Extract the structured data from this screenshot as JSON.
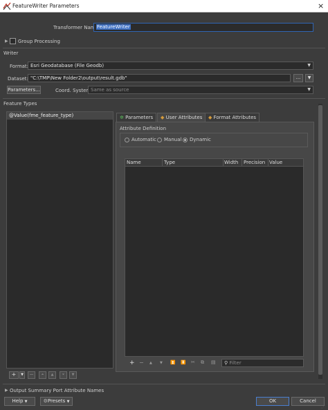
{
  "window": {
    "title": "FeatureWriter Parameters",
    "close_glyph": "×"
  },
  "transformer": {
    "label": "Transformer Name:",
    "value": "FeatureWriter"
  },
  "group_processing": {
    "label": "Group Processing",
    "checked": false
  },
  "writer": {
    "section_label": "Writer",
    "format_label": "Format:",
    "format_value": "Esri Geodatabase (File Geodb)",
    "dataset_label": "Dataset:",
    "dataset_value": "\"C:\\TMP\\New Folder2\\output\\result.gdb\"",
    "browse_label": "...",
    "parameters_button": "Parameters...",
    "coord_label": "Coord. System:",
    "coord_placeholder": "Same as source"
  },
  "feature_types": {
    "section_label": "Feature Types",
    "items": [
      "@Value(fme_feature_type)"
    ]
  },
  "tabs": [
    {
      "label": "Parameters",
      "icon": "gear-icon",
      "active": false
    },
    {
      "label": "User Attributes",
      "icon": "diamond-icon",
      "active": true
    },
    {
      "label": "Format Attributes",
      "icon": "diamond-icon",
      "active": false
    }
  ],
  "attribute_definition": {
    "label": "Attribute Definition",
    "options": [
      "Automatic",
      "Manual",
      "Dynamic"
    ],
    "selected": "Dynamic"
  },
  "attr_table": {
    "columns": [
      "Name",
      "Type",
      "Width",
      "Precision",
      "Value"
    ]
  },
  "table_toolbar": {
    "add": "+",
    "remove": "−",
    "up": "▲",
    "down": "▼",
    "filter_placeholder": "Filter"
  },
  "feature_toolbar": {
    "add": "+",
    "remove": "−"
  },
  "output_summary": {
    "label": "Output Summary Port Attribute Names"
  },
  "footer": {
    "help": "Help",
    "presets": "Presets",
    "ok": "OK",
    "cancel": "Cancel"
  },
  "colors": {
    "accent": "#2f65b4",
    "selection": "#3d6fc2",
    "ok_border": "#4a7fd0"
  }
}
